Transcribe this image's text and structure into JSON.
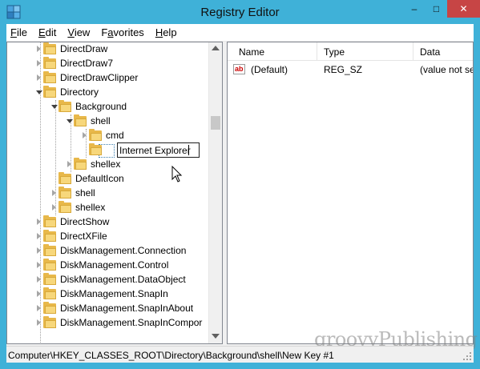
{
  "window": {
    "title": "Registry Editor",
    "minimize_glyph": "–",
    "maximize_glyph": "□",
    "close_glyph": "✕"
  },
  "menu": [
    {
      "accel": "F",
      "rest": "ile"
    },
    {
      "accel": "E",
      "rest": "dit"
    },
    {
      "accel": "V",
      "rest": "iew"
    },
    {
      "accel": "",
      "pre": "F",
      "accel2": "a",
      "rest": "vorites"
    },
    {
      "accel": "H",
      "rest": "elp"
    }
  ],
  "menu_labels": [
    "File",
    "Edit",
    "View",
    "Favorites",
    "Help"
  ],
  "tree": {
    "items": [
      {
        "label": "DirectDraw",
        "expander": "right"
      },
      {
        "label": "DirectDraw7",
        "expander": "right"
      },
      {
        "label": "DirectDrawClipper",
        "expander": "right"
      },
      {
        "label": "Directory",
        "expander": "down"
      },
      {
        "label": "Background",
        "expander": "down"
      },
      {
        "label": "shell",
        "expander": "down"
      },
      {
        "label": "cmd",
        "expander": "right"
      },
      {
        "label": "Internet Explorer",
        "expander": "none",
        "editing": true
      },
      {
        "label": "shellex",
        "expander": "right"
      },
      {
        "label": "DefaultIcon",
        "expander": "none"
      },
      {
        "label": "shell",
        "expander": "right"
      },
      {
        "label": "shellex",
        "expander": "right"
      },
      {
        "label": "DirectShow",
        "expander": "right"
      },
      {
        "label": "DirectXFile",
        "expander": "right"
      },
      {
        "label": "DiskManagement.Connection",
        "expander": "right"
      },
      {
        "label": "DiskManagement.Control",
        "expander": "right"
      },
      {
        "label": "DiskManagement.DataObject",
        "expander": "right"
      },
      {
        "label": "DiskManagement.SnapIn",
        "expander": "right"
      },
      {
        "label": "DiskManagement.SnapInAbout",
        "expander": "right"
      },
      {
        "label": "DiskManagement.SnapInCompor",
        "expander": "right"
      }
    ]
  },
  "list": {
    "columns": [
      "Name",
      "Type",
      "Data"
    ],
    "rows": [
      {
        "name": "(Default)",
        "type": "REG_SZ",
        "data": "(value not set)",
        "icon": "string-value-icon"
      }
    ]
  },
  "status": {
    "path": "Computer\\HKEY_CLASSES_ROOT\\Directory\\Background\\shell\\New Key #1"
  },
  "watermark": "groovyPublishing",
  "colors": {
    "titlebar": "#3fb1d8",
    "close": "#c74545",
    "folder": "#e8b84a"
  }
}
